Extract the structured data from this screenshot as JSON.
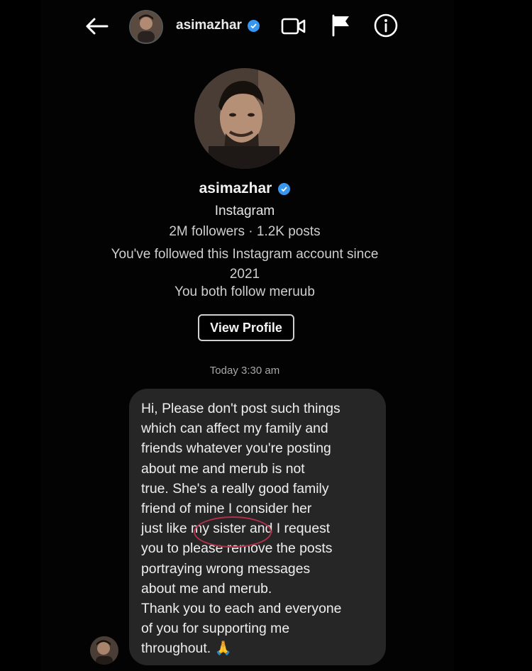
{
  "header": {
    "back_icon": "arrow-left-icon",
    "username": "asimazhar",
    "video_icon": "video-camera-icon",
    "report_icon": "flag-icon",
    "info_icon": "info-icon"
  },
  "profile": {
    "username": "asimazhar",
    "platform": "Instagram",
    "stats": "2M followers · 1.2K posts",
    "followed_since_line1": "You've followed this Instagram account since",
    "followed_since_line2": "2021",
    "mutual": "You both follow meruub",
    "view_profile_label": "View Profile"
  },
  "thread": {
    "timestamp": "Today 3:30 am",
    "message_lines": [
      "Hi, Please don't post such things",
      "which can affect my family and",
      "friends whatever you're posting",
      "about me and merub is not",
      "true. She's a really good family",
      "friend of mine I consider her",
      "just like my sister and I request",
      "you to please remove the posts",
      "portraying wrong messages",
      "about me and merub.",
      "Thank you to each and everyone",
      "of you for supporting me",
      "throughout. 🙏"
    ]
  },
  "colors": {
    "background": "#000000",
    "bubble": "#262626",
    "verified": "#3797f0",
    "highlight_circle": "#b0304a"
  }
}
